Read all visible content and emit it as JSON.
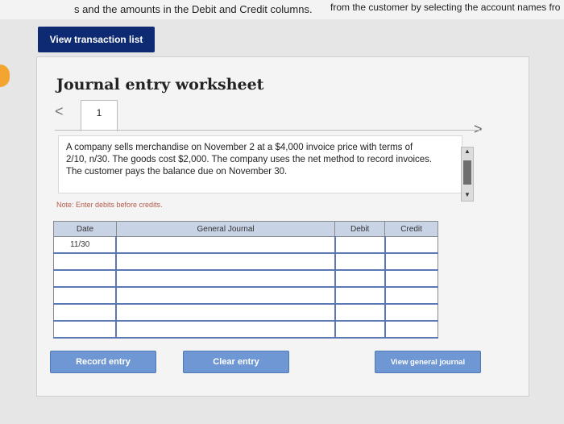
{
  "top": {
    "line_fragment": "ceipt of cash from the customer by selecting the account names fro",
    "line_main": "s and the amounts in the Debit and Credit columns.",
    "right_fragment": "from the customer by selecting the account names fro"
  },
  "buttons": {
    "view_transaction_list": "View transaction list",
    "record_entry": "Record entry",
    "clear_entry": "Clear entry",
    "view_general_journal": "View general journal"
  },
  "worksheet": {
    "title": "Journal entry worksheet",
    "tab_number": "1",
    "nav_prev": "<",
    "nav_next": ">",
    "description": "A company sells merchandise on November 2 at a $4,000 invoice price with terms of 2/10, n/30. The goods cost $2,000. The company uses the net method to record invoices. The customer pays the balance due on November 30.",
    "note": "Note: Enter debits before credits."
  },
  "journal": {
    "headers": {
      "date": "Date",
      "general_journal": "General Journal",
      "debit": "Debit",
      "credit": "Credit"
    },
    "rows": [
      {
        "date": "11/30",
        "account": "",
        "debit": "",
        "credit": ""
      },
      {
        "date": "",
        "account": "",
        "debit": "",
        "credit": ""
      },
      {
        "date": "",
        "account": "",
        "debit": "",
        "credit": ""
      },
      {
        "date": "",
        "account": "",
        "debit": "",
        "credit": ""
      },
      {
        "date": "",
        "account": "",
        "debit": "",
        "credit": ""
      },
      {
        "date": "",
        "account": "",
        "debit": "",
        "credit": ""
      }
    ]
  },
  "colors": {
    "primary_button": "#0d2a73",
    "action_button": "#6f97d4",
    "table_header": "#c9d3e6",
    "note_text": "#b45a4a"
  }
}
